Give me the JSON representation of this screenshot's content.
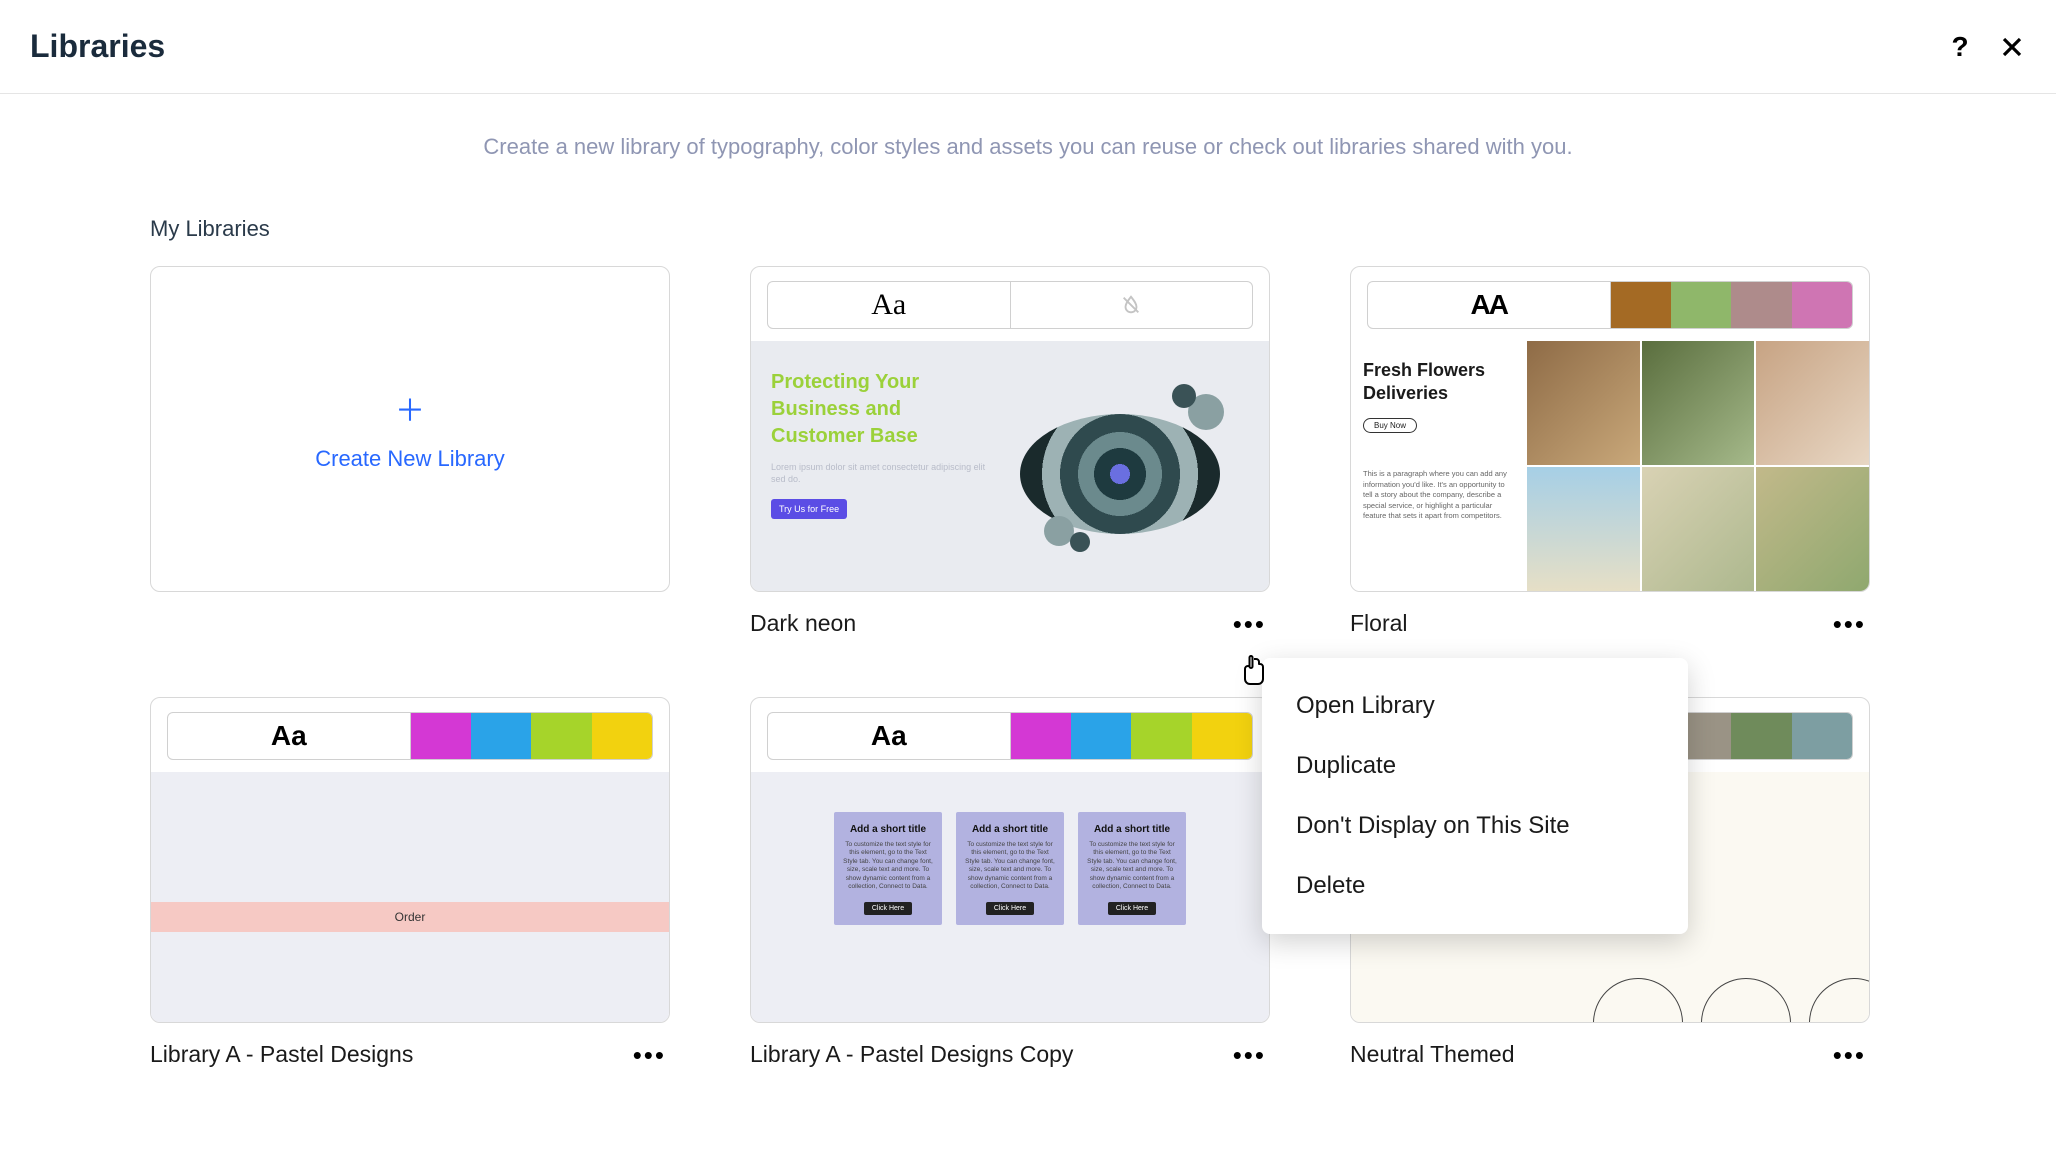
{
  "header": {
    "title": "Libraries"
  },
  "subtitle": "Create a new library of typography, color styles and assets you can reuse or check out libraries shared with you.",
  "section_title": "My Libraries",
  "create_label": "Create New Library",
  "cards": {
    "dark_neon": {
      "title": "Dark neon",
      "font_sample": "Aa",
      "headline": "Protecting Your Business and Customer Base",
      "cta": "Try Us for Free"
    },
    "floral": {
      "title": "Floral",
      "font_sample": "AA",
      "headline": "Fresh Flowers Deliveries",
      "button": "Buy Now",
      "swatches": [
        "#a46a24",
        "#8fb76a",
        "#ae8b8b",
        "#cf75b3"
      ]
    },
    "lib_a": {
      "title": "Library A - Pastel Designs",
      "font_sample": "Aa",
      "order_label": "Order",
      "swatches": [
        "#d438d4",
        "#2aa3e8",
        "#a6d42a",
        "#f2d20f"
      ]
    },
    "lib_a_copy": {
      "title": "Library A - Pastel Designs Copy",
      "font_sample": "Aa",
      "mini_title": "Add a short title",
      "mini_body": "To customize the text style for this element, go to the Text Style tab. You can change font, size, scale text and more. To show dynamic content from a collection, Connect to Data.",
      "mini_btn": "Click Here",
      "swatches": [
        "#d438d4",
        "#2aa3e8",
        "#a6d42a",
        "#f2d20f"
      ]
    },
    "neutral": {
      "title": "Neutral Themed",
      "swatches": [
        "#e7c45a",
        "#9a9385",
        "#6f8b5b",
        "#7d9ea2"
      ]
    }
  },
  "context_menu": {
    "items": [
      "Open Library",
      "Duplicate",
      "Don't Display on This Site",
      "Delete"
    ]
  }
}
